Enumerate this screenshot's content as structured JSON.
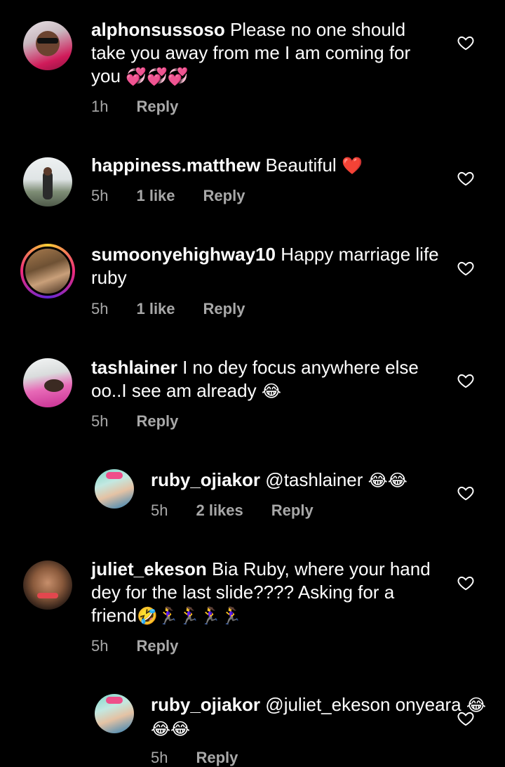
{
  "comments": [
    {
      "username": "alphonsussoso",
      "text": "Please no one should take you away from me I am coming for you",
      "emoji": "💞💞💞",
      "time": "1h",
      "likes": "",
      "reply": "Reply"
    },
    {
      "username": "happiness.matthew",
      "text": "Beautiful",
      "emoji": "❤️",
      "time": "5h",
      "likes": "1 like",
      "reply": "Reply"
    },
    {
      "username": "sumoonyehighway10",
      "text": "Happy marriage life ruby",
      "emoji": "",
      "time": "5h",
      "likes": "1 like",
      "reply": "Reply"
    },
    {
      "username": "tashlainer",
      "text": "I no dey focus anywhere else oo..I see  am already",
      "emoji": "😂",
      "time": "5h",
      "likes": "",
      "reply": "Reply"
    },
    {
      "username": "ruby_ojiakor",
      "text": "@tashlainer",
      "emoji": "😂😂",
      "time": "5h",
      "likes": "2 likes",
      "reply": "Reply"
    },
    {
      "username": "juliet_ekeson",
      "text": "Bia Ruby, where your hand dey for the last slide???? Asking for a friend",
      "emoji": "🤣🏃‍♀️🏃‍♀️🏃‍♀️🏃‍♀️",
      "time": "5h",
      "likes": "",
      "reply": "Reply"
    },
    {
      "username": "ruby_ojiakor",
      "text": "@juliet_ekeson onyeara",
      "emoji": "😂😂😂",
      "time": "5h",
      "likes": "",
      "reply": "Reply"
    }
  ]
}
